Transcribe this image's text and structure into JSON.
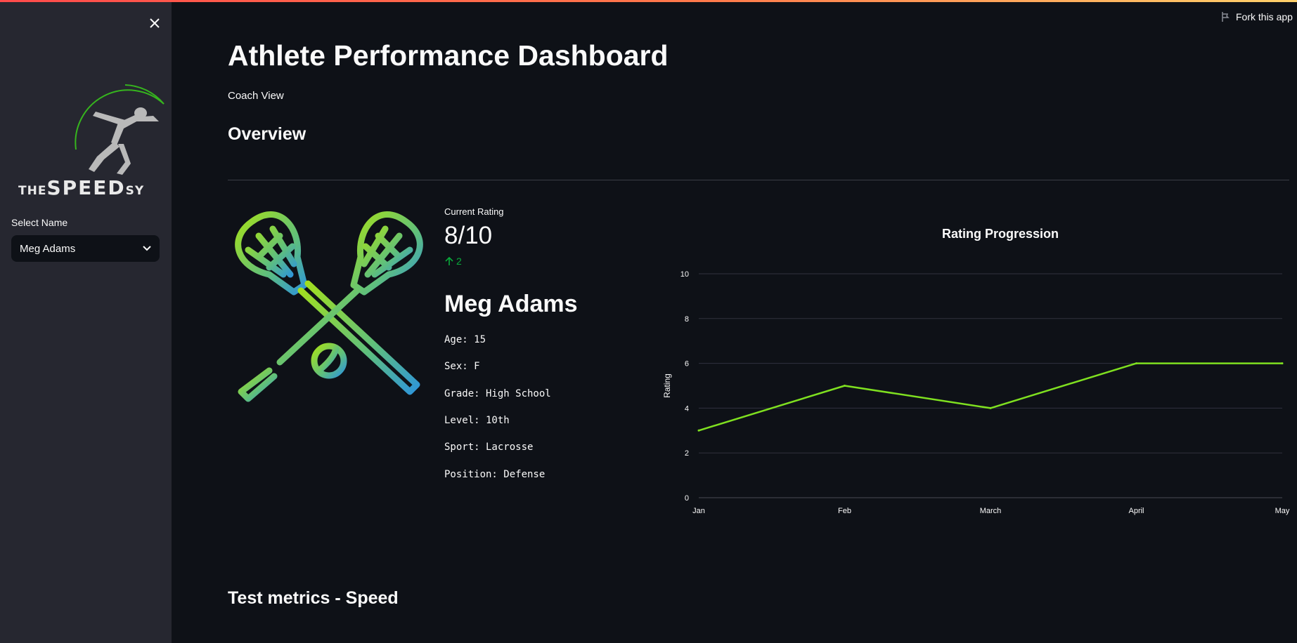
{
  "sidebar": {
    "logo": {
      "text_small_left": "THE",
      "text_big": "SPEED",
      "text_small_right": "SY"
    },
    "select_label": "Select Name",
    "select_value": "Meg Adams"
  },
  "header": {
    "fork_label": "Fork this app"
  },
  "main": {
    "title": "Athlete Performance Dashboard",
    "subtitle": "Coach View",
    "overview_heading": "Overview",
    "speed_heading": "Test metrics - Speed"
  },
  "metric": {
    "label": "Current Rating",
    "value": "8/10",
    "delta": "2"
  },
  "athlete": {
    "name": "Meg Adams",
    "details": [
      "Age: 15",
      "Sex: F",
      "Grade: High School",
      "Level: 10th",
      "Sport: Lacrosse",
      "Position: Defense"
    ]
  },
  "colors": {
    "accent": "#7fe020",
    "positive": "#09ab3b",
    "background": "#0e1117",
    "sidebar": "#262730"
  },
  "chart_data": {
    "type": "line",
    "title": "Rating Progression",
    "xlabel": "",
    "ylabel": "Rating",
    "categories": [
      "Jan",
      "Feb",
      "March",
      "April",
      "May"
    ],
    "series": [
      {
        "values": [
          3,
          5,
          4,
          6,
          6
        ]
      }
    ],
    "ylim": [
      0,
      10
    ],
    "yticks": [
      0,
      2,
      4,
      6,
      8,
      10
    ],
    "grid": true
  }
}
